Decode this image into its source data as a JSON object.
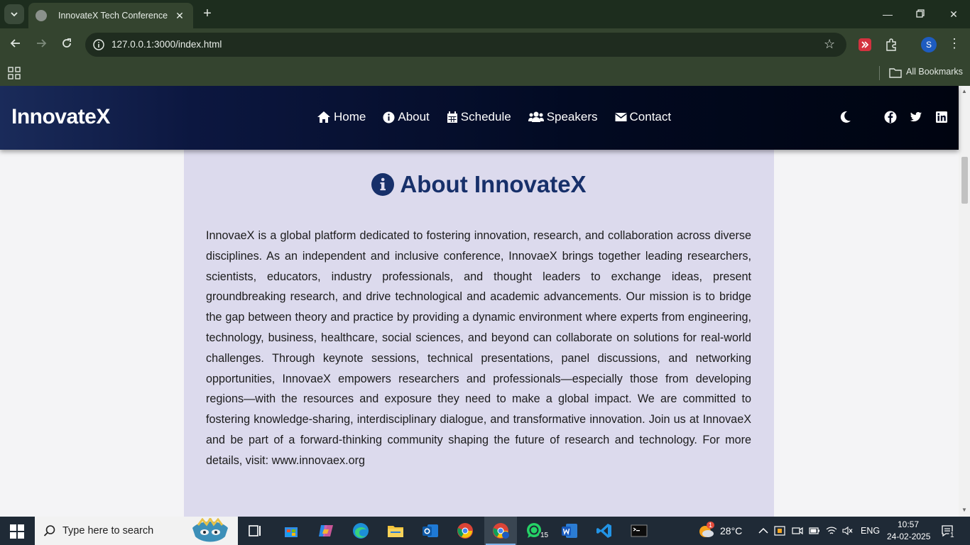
{
  "browser": {
    "tab_title": "InnovateX Tech Conference",
    "url": "127.0.0.1:3000/index.html",
    "bookmarks_label": "All Bookmarks",
    "profile_initial": "S"
  },
  "site": {
    "logo": "InnovateX",
    "nav": [
      {
        "label": "Home",
        "icon": "home-icon"
      },
      {
        "label": "About",
        "icon": "info-icon"
      },
      {
        "label": "Schedule",
        "icon": "calendar-icon"
      },
      {
        "label": "Speakers",
        "icon": "users-icon"
      },
      {
        "label": "Contact",
        "icon": "envelope-icon"
      }
    ],
    "social": [
      "facebook-icon",
      "twitter-icon",
      "linkedin-icon"
    ],
    "about": {
      "heading": "About InnovateX",
      "body": "InnovaeX is a global platform dedicated to fostering innovation, research, and collaboration across diverse disciplines. As an independent and inclusive conference, InnovaeX brings together leading researchers, scientists, educators, industry professionals, and thought leaders to exchange ideas, present groundbreaking research, and drive technological and academic advancements. Our mission is to bridge the gap between theory and practice by providing a dynamic environment where experts from engineering, technology, business, healthcare, social sciences, and beyond can collaborate on solutions for real-world challenges. Through keynote sessions, technical presentations, panel discussions, and networking opportunities, InnovaeX empowers researchers and professionals—especially those from developing regions—with the resources and exposure they need to make a global impact. We are committed to fostering knowledge-sharing, interdisciplinary dialogue, and transformative innovation. Join us at InnovaeX and be part of a forward-thinking community shaping the future of research and technology. For more details, visit: www.innovaex.org"
    }
  },
  "taskbar": {
    "search_placeholder": "Type here to search",
    "whatsapp_badge": "15",
    "weather_temp": "28°C",
    "weather_badge": "1",
    "language": "ENG",
    "time": "10:57",
    "date": "24-02-2025",
    "notification_count": "1"
  },
  "colors": {
    "accent": "#17306a",
    "card_bg": "#dcdaed",
    "browser_frame": "#34442f"
  }
}
